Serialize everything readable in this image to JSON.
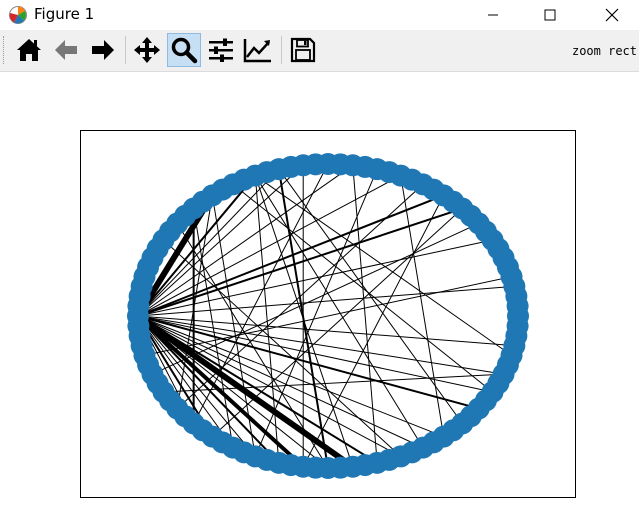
{
  "window": {
    "title": "Figure 1"
  },
  "toolbar": {
    "tools": [
      {
        "name": "home-icon"
      },
      {
        "name": "back-arrow-icon"
      },
      {
        "name": "forward-arrow-icon"
      },
      {
        "name": "pan-icon"
      },
      {
        "name": "zoom-icon",
        "active": true
      },
      {
        "name": "subplots-icon"
      },
      {
        "name": "edit-axes-icon"
      },
      {
        "name": "save-icon"
      }
    ],
    "status": "zoom rect"
  },
  "colors": {
    "node": "#1f77b4",
    "edge": "#000000",
    "active_tool": "#c7dff5"
  },
  "chart_data": {
    "type": "network",
    "layout": "circular",
    "node_count": 96,
    "grid": false
  }
}
